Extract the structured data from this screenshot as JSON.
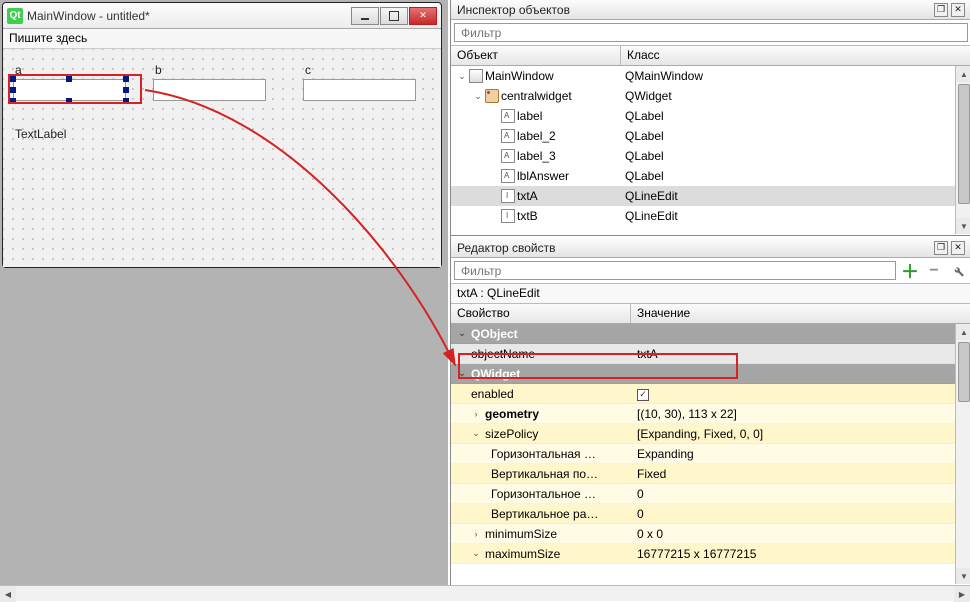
{
  "designer": {
    "windowTitle": "MainWindow - untitled*",
    "menuPlaceholder": "Пишите здесь",
    "labels": {
      "a": "a",
      "b": "b",
      "c": "c",
      "textLabel": "TextLabel"
    }
  },
  "inspector": {
    "title": "Инспектор объектов",
    "filterPlaceholder": "Фильтр",
    "columns": {
      "object": "Объект",
      "class": "Класс"
    },
    "tree": [
      {
        "name": "MainWindow",
        "class": "QMainWindow"
      },
      {
        "name": "centralwidget",
        "class": "QWidget"
      },
      {
        "name": "label",
        "class": "QLabel"
      },
      {
        "name": "label_2",
        "class": "QLabel"
      },
      {
        "name": "label_3",
        "class": "QLabel"
      },
      {
        "name": "lblAnswer",
        "class": "QLabel"
      },
      {
        "name": "txtA",
        "class": "QLineEdit"
      },
      {
        "name": "txtB",
        "class": "QLineEdit"
      }
    ]
  },
  "propEditor": {
    "title": "Редактор свойств",
    "filterPlaceholder": "Фильтр",
    "objectLine": "txtA : QLineEdit",
    "columns": {
      "prop": "Свойство",
      "value": "Значение"
    },
    "groups": {
      "qobject": "QObject",
      "qwidget": "QWidget"
    },
    "rows": {
      "objectName": {
        "label": "objectName",
        "value": "txtA"
      },
      "enabled": {
        "label": "enabled",
        "checked": true
      },
      "geometry": {
        "label": "geometry",
        "value": "[(10, 30), 113 x 22]"
      },
      "sizePolicy": {
        "label": "sizePolicy",
        "value": "[Expanding, Fixed, 0, 0]"
      },
      "horizPolicy": {
        "label": "Горизонтальная …",
        "value": "Expanding"
      },
      "vertPolicy": {
        "label": "Вертикальная по…",
        "value": "Fixed"
      },
      "horizStretch": {
        "label": "Горизонтальное …",
        "value": "0"
      },
      "vertStretch": {
        "label": "Вертикальное ра…",
        "value": "0"
      },
      "minimumSize": {
        "label": "minimumSize",
        "value": "0 x 0"
      },
      "maximumSize": {
        "label": "maximumSize",
        "value": "16777215 x 16777215"
      }
    }
  }
}
